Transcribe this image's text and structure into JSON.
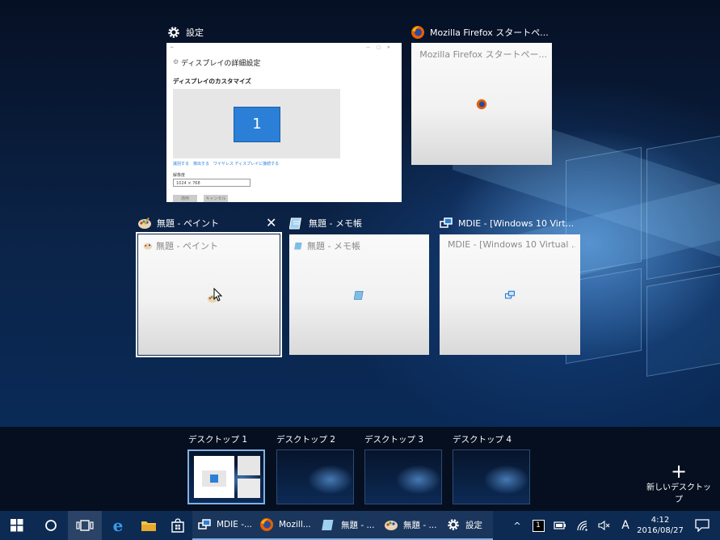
{
  "windows": {
    "settings": {
      "title": "設定",
      "panel_title": "ディスプレイの詳細設定",
      "section": "ディスプレイのカスタマイズ",
      "monitor_number": "1",
      "links": "識別する　検出する　ワイヤレス ディスプレイに接続する",
      "resolution_label": "解像度",
      "resolution_value": "1024 × 768",
      "apply": "適用",
      "cancel": "キャンセル"
    },
    "firefox": {
      "title": "Mozilla Firefox スタートペ...",
      "caption": "Mozilla Firefox スタートペー..."
    },
    "paint": {
      "title": "無題 - ペイント",
      "caption": "無題 - ペイント",
      "close": "✕"
    },
    "notepad": {
      "title": "無題 - メモ帳",
      "caption": "無題 - メモ帳"
    },
    "mdie": {
      "title": "MDIE - [Windows 10 Virt...",
      "caption": "MDIE - [Windows 10 Virtual ..."
    }
  },
  "desktops": [
    {
      "label": "デスクトップ 1",
      "active": true
    },
    {
      "label": "デスクトップ 2",
      "active": false
    },
    {
      "label": "デスクトップ 3",
      "active": false
    },
    {
      "label": "デスクトップ 4",
      "active": false
    }
  ],
  "new_desktop": {
    "plus": "+",
    "label": "新しいデスクトップ"
  },
  "taskbar": {
    "apps": [
      {
        "label": "MDIE -..."
      },
      {
        "label": "Mozill..."
      },
      {
        "label": "無題 - ..."
      },
      {
        "label": "無題 - ..."
      },
      {
        "label": "設定"
      }
    ],
    "tray": {
      "chevron": "^",
      "badge": "1",
      "ime": "A",
      "time": "4:12",
      "date": "2016/08/27"
    }
  }
}
